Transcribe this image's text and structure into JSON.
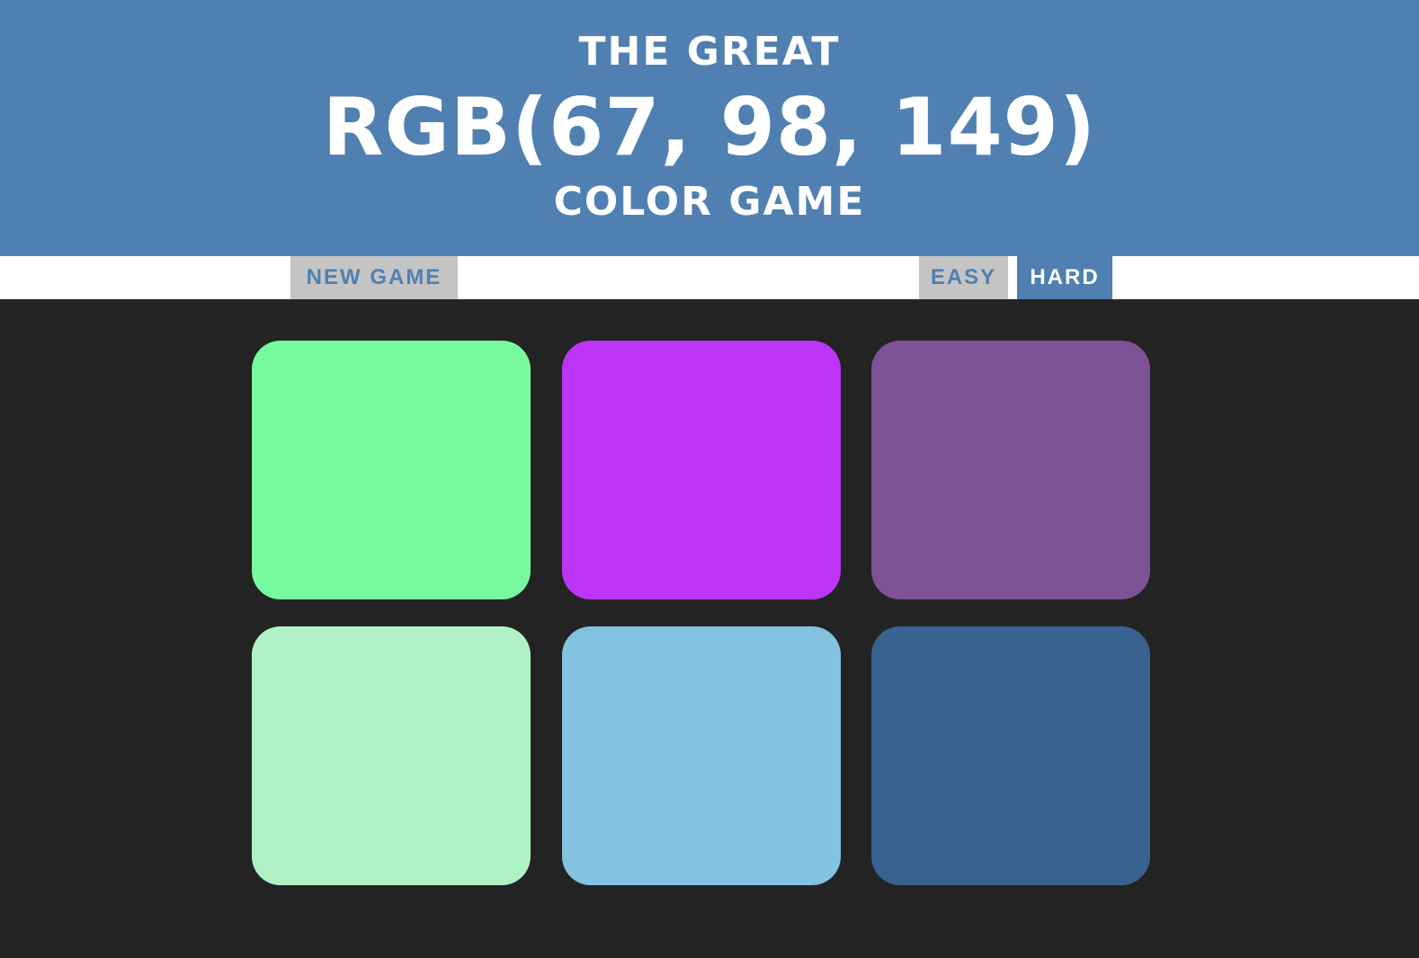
{
  "header": {
    "title_top": "THE GREAT",
    "target_rgb": "RGB(67, 98, 149)",
    "title_bottom": "COLOR GAME",
    "background": "#4F80B1",
    "text_color": "#FFFFFF"
  },
  "stripe": {
    "new_game_label": "NEW GAME",
    "easy_label": "EASY",
    "hard_label": "HARD",
    "selected_mode": "HARD",
    "accent_color": "#4F80B1",
    "button_bg": "#C4C4C4"
  },
  "board": {
    "background": "#232323",
    "squares": [
      {
        "color": "#76F99F"
      },
      {
        "color": "#BC35F7"
      },
      {
        "color": "#7D5196"
      },
      {
        "color": "#B0F2C6"
      },
      {
        "color": "#83C2E0"
      },
      {
        "color": "#3A6291"
      }
    ]
  }
}
